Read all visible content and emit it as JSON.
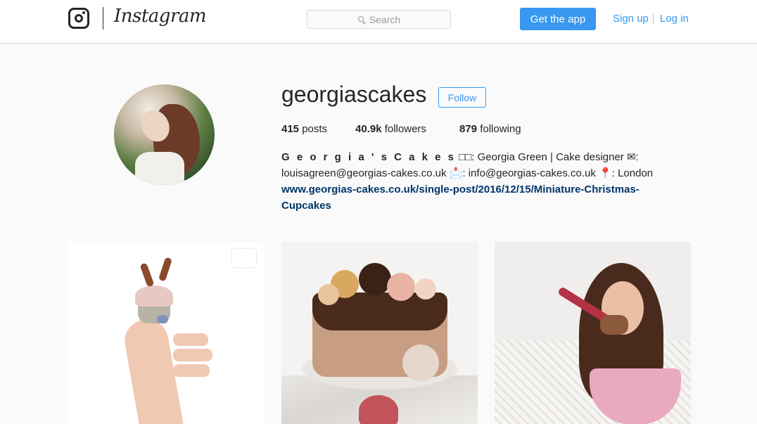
{
  "header": {
    "logo_icon": "instagram-camera-icon",
    "wordmark": "Instagram",
    "search_placeholder": "Search",
    "search_icon": "search-icon",
    "get_app_label": "Get the app",
    "signup_label": "Sign up",
    "login_label": "Log in"
  },
  "profile": {
    "username": "georgiascakes",
    "follow_label": "Follow",
    "stats": {
      "posts_count": "415",
      "posts_label": "posts",
      "followers_count": "40.9k",
      "followers_label": "followers",
      "following_count": "879",
      "following_label": "following"
    },
    "bio": {
      "name": "G e o r g i a ' s C a k e s",
      "emoji_placeholder": "□□",
      "line1_rest": ": Georgia Green | Cake designer",
      "mail_icon": "✉",
      "line2a": ": louisagreen@georgias-cakes.co.uk",
      "envelope_icon": "📩",
      "line2b": ": info@georgias-cakes.co.uk",
      "pin_icon": "📍",
      "line2c": ": London",
      "link": "www.georgias-cakes.co.uk/single-post/2016/12/15/Miniature-Christmas-Cupcakes"
    }
  },
  "posts": [
    {
      "subject": "reindeer-cupcake-in-hand",
      "has_video": true,
      "video_icon": "video-camera-icon"
    },
    {
      "subject": "chocolate-drip-cake"
    },
    {
      "subject": "woman-with-mixing-bowl"
    }
  ],
  "colors": {
    "accent": "#3897f0",
    "link": "#003569",
    "text": "#262626",
    "background": "#fafafa"
  }
}
